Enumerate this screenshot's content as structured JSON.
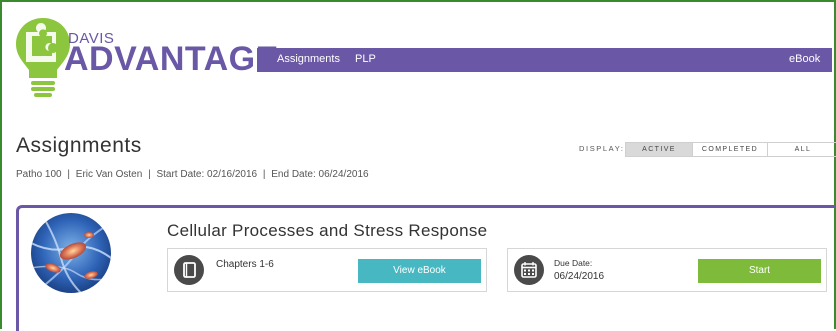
{
  "brand": {
    "small": "DAVIS",
    "large": "ADVANTAGE",
    "colors": {
      "primary": "#6a57a6",
      "accent_green": "#7fbb3a",
      "accent_teal": "#47b8c2",
      "frame_green": "#3a8a2e"
    }
  },
  "nav": {
    "items": [
      "Assignments",
      "PLP"
    ],
    "right_item": "eBook"
  },
  "page": {
    "title": "Assignments",
    "display_label": "DISPLAY:",
    "filters": [
      "ACTIVE",
      "COMPLETED",
      "ALL"
    ],
    "active_filter": "ACTIVE",
    "course": "Patho 100",
    "instructor": "Eric Van Osten",
    "start_date": "Start Date: 02/16/2016",
    "end_date": "End Date: 06/24/2016",
    "separator": "|"
  },
  "assignment": {
    "title": "Cellular Processes and Stress Response",
    "chapters": "Chapters 1-6",
    "view_ebook_label": "View eBook",
    "due_label": "Due Date:",
    "due_date": "06/24/2016",
    "start_label": "Start",
    "icons": {
      "book": "book-icon",
      "calendar": "calendar-icon",
      "image": "cell-image"
    }
  }
}
